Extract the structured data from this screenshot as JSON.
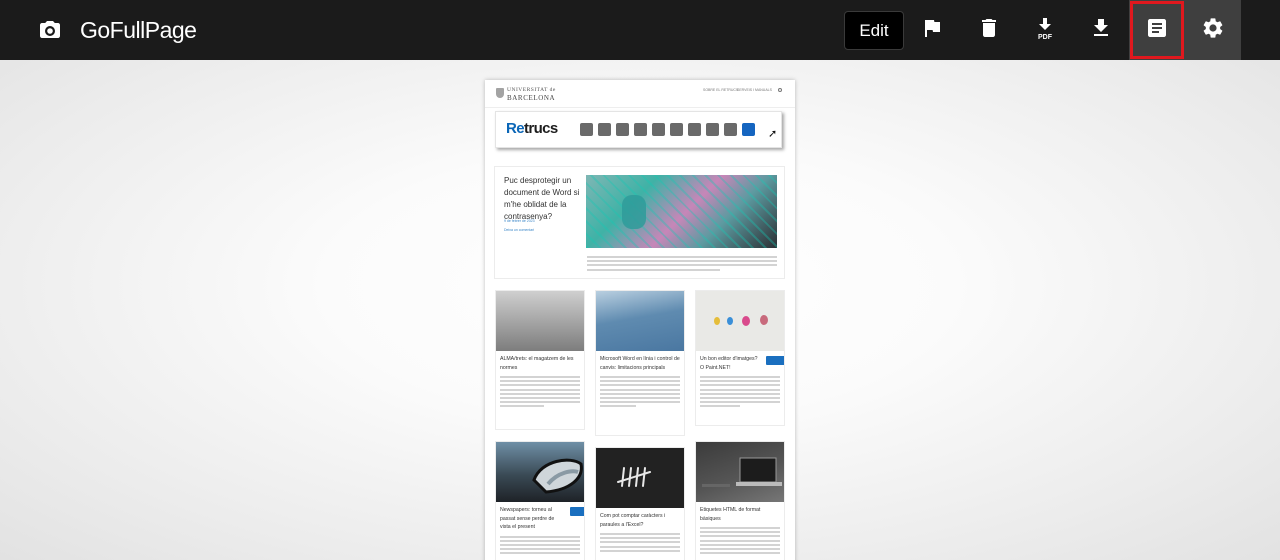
{
  "toolbar": {
    "app_title": "GoFullPage",
    "edit_label": "Edit",
    "buttons": [
      {
        "name": "flag",
        "icon": "flag-icon"
      },
      {
        "name": "delete",
        "icon": "trash-icon"
      },
      {
        "name": "download-pdf",
        "icon": "download-pdf-icon",
        "label": "PDF"
      },
      {
        "name": "download",
        "icon": "download-icon"
      },
      {
        "name": "document",
        "icon": "document-icon",
        "active": true,
        "highlighted": true
      },
      {
        "name": "settings",
        "icon": "gear-icon",
        "active": true
      }
    ],
    "highlight_color": "#e0181e"
  },
  "preview": {
    "header": {
      "logo_line1": "UNIVERSITAT de",
      "logo_line2": "BARCELONA",
      "nav_1": "SOBRE EL RETRUCS",
      "nav_2": "SERVEIS I MANUALS"
    },
    "banner": {
      "title_prefix": "Re",
      "title_suffix": "trucs"
    },
    "featured": {
      "title": "Puc desprotegir un document de Word si m'he oblidat de la contrasenya?",
      "meta_date": "9 de febrer de 2023",
      "meta_link": "Deixa un comentari"
    },
    "cards": [
      {
        "title": "ALMA/trets: el magatzem de les normes"
      },
      {
        "title": "Microsoft Word en línia i control de canvis: limitacions principals"
      },
      {
        "title": "Un bon editor d'imatges? O Paint.NET!"
      },
      {
        "title": "Newspapers: torneu al passat sense perdre de vista el present"
      },
      {
        "title": "Com pot comptar caràcters i paraules a l'Excel?"
      },
      {
        "title": "Etiquetes HTML de format bàsiques"
      }
    ]
  }
}
